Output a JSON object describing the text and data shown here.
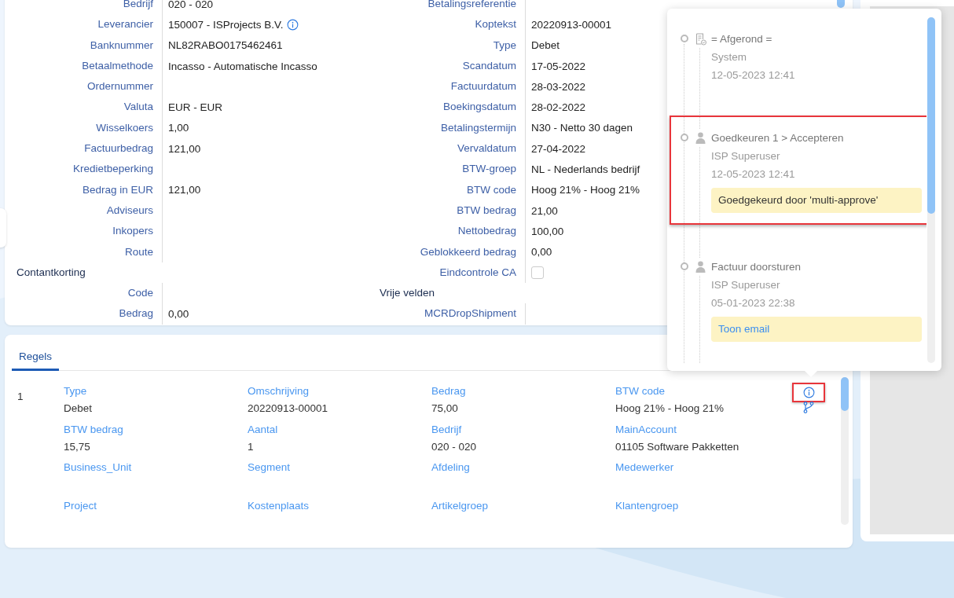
{
  "details": {
    "columns": [
      {
        "items": [
          {
            "kind": "field",
            "label": "Bedrijf",
            "value": "020 - 020"
          },
          {
            "kind": "lookup",
            "label": "Leverancier",
            "value": "150007 - ISProjects B.V."
          },
          {
            "kind": "field",
            "label": "Banknummer",
            "value": "NL82RABO0175462461"
          },
          {
            "kind": "field",
            "label": "Betaalmethode",
            "value": "Incasso - Automatische Incasso"
          },
          {
            "kind": "field",
            "label": "Ordernummer"
          },
          {
            "kind": "field",
            "label": "Valuta",
            "value": "EUR - EUR"
          },
          {
            "kind": "field",
            "label": "Wisselkoers",
            "value": "1,00"
          },
          {
            "kind": "field",
            "label": "Factuurbedrag",
            "value": "121,00"
          },
          {
            "kind": "field",
            "label": "Kredietbeperking"
          },
          {
            "kind": "field",
            "label": "Bedrag in EUR",
            "value": "121,00"
          },
          {
            "kind": "field",
            "label": "Adviseurs"
          },
          {
            "kind": "field",
            "label": "Inkopers"
          },
          {
            "kind": "field",
            "label": "Route"
          },
          {
            "kind": "section",
            "title": "Contantkorting"
          },
          {
            "kind": "field",
            "label": "Code"
          },
          {
            "kind": "field",
            "label": "Bedrag",
            "value": "0,00"
          }
        ]
      },
      {
        "items": [
          {
            "kind": "field",
            "label": "Betalingsreferentie"
          },
          {
            "kind": "field",
            "label": "Koptekst",
            "value": "20220913-00001"
          },
          {
            "kind": "field",
            "label": "Type",
            "value": "Debet"
          },
          {
            "kind": "field",
            "label": "Scandatum",
            "value": "17-05-2022"
          },
          {
            "kind": "field",
            "label": "Factuurdatum",
            "value": "28-03-2022"
          },
          {
            "kind": "field",
            "label": "Boekingsdatum",
            "value": "28-02-2022"
          },
          {
            "kind": "field",
            "label": "Betalingstermijn",
            "value": "N30 - Netto 30 dagen"
          },
          {
            "kind": "field",
            "label": "Vervaldatum",
            "value": "27-04-2022"
          },
          {
            "kind": "field",
            "label": "BTW-groep",
            "value": "NL - Nederlands bedrijf"
          },
          {
            "kind": "field",
            "label": "BTW code",
            "value": "Hoog 21% - Hoog 21%"
          },
          {
            "kind": "field",
            "label": "BTW bedrag",
            "value": "21,00"
          },
          {
            "kind": "field",
            "label": "Nettobedrag",
            "value": "100,00"
          },
          {
            "kind": "field",
            "label": "Geblokkeerd bedrag",
            "value": "0,00"
          },
          {
            "kind": "check",
            "label": "Eindcontrole CA",
            "checked": false
          },
          {
            "kind": "section",
            "title": "Vrije velden"
          },
          {
            "kind": "field",
            "label": "MCRDropShipment"
          }
        ]
      }
    ]
  },
  "lines": {
    "tabs": [
      {
        "label": "Regels",
        "selected": true
      }
    ],
    "rows": [
      {
        "number": "1",
        "info_highlighted": true,
        "fields": [
          {
            "label": "Type",
            "value": "Debet"
          },
          {
            "label": "Omschrijving",
            "value": "20220913-00001"
          },
          {
            "label": "Bedrag",
            "value": "75,00"
          },
          {
            "label": "BTW code",
            "value": "Hoog 21% - Hoog 21%"
          },
          {
            "label": "BTW bedrag",
            "value": "15,75"
          },
          {
            "label": "Aantal",
            "value": "1"
          },
          {
            "label": "Bedrijf",
            "value": "020 - 020"
          },
          {
            "label": "MainAccount",
            "value": "01105 Software Pakketten"
          },
          {
            "label": "Business_Unit"
          },
          {
            "label": "Segment"
          },
          {
            "label": "Afdeling"
          },
          {
            "label": "Medewerker"
          },
          {
            "label": "Project"
          },
          {
            "label": "Kostenplaats"
          },
          {
            "label": "Artikelgroep"
          },
          {
            "label": "Klantengroep"
          }
        ]
      }
    ]
  },
  "history": {
    "entries": [
      {
        "kind": "document",
        "title": "= Afgerond =",
        "user": "System",
        "date": "12-05-2023 12:41",
        "highlighted": false
      },
      {
        "kind": "user",
        "title": "Goedkeuren 1 > Accepteren",
        "user": "ISP Superuser",
        "date": "12-05-2023 12:41",
        "highlighted": true,
        "note": {
          "kind": "text",
          "text": "Goedgekeurd door 'multi-approve'"
        }
      },
      {
        "kind": "user",
        "title": "Factuur doorsturen",
        "user": "ISP Superuser",
        "date": "05-01-2023 22:38",
        "highlighted": false,
        "note": {
          "kind": "link",
          "text": "Toon email"
        }
      }
    ]
  }
}
